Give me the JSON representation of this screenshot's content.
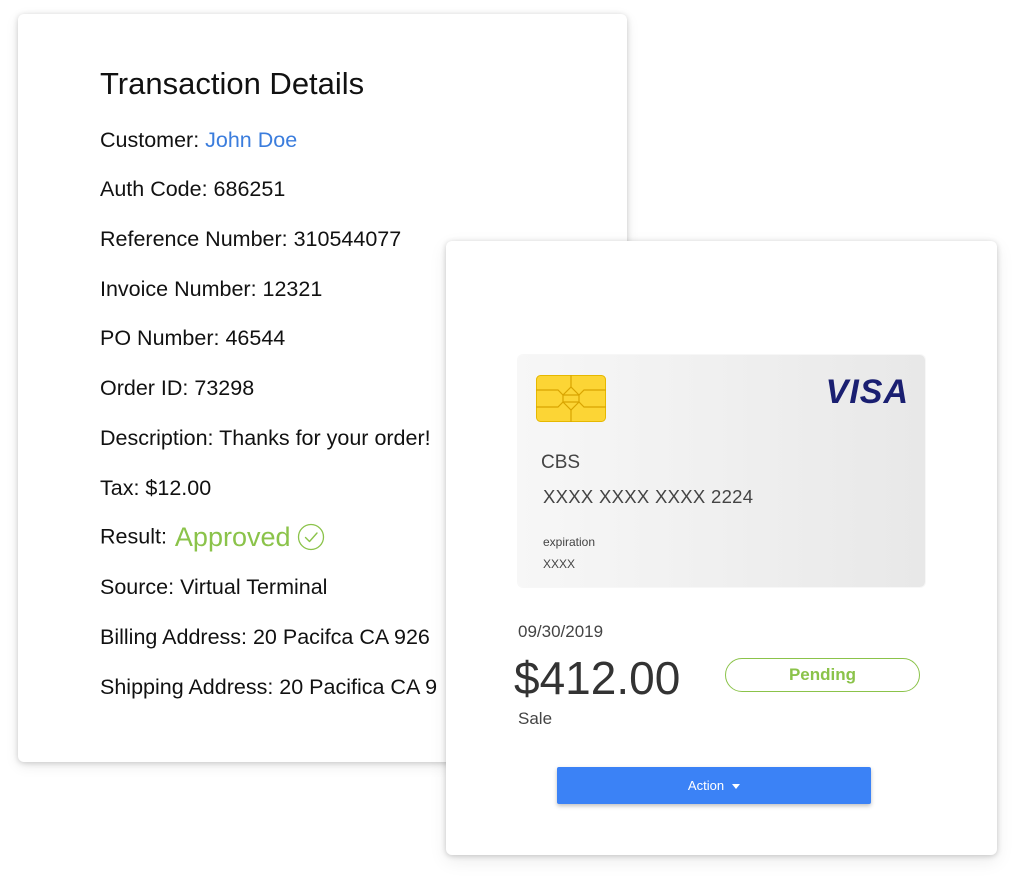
{
  "details": {
    "title": "Transaction Details",
    "customer_label": "Customer: ",
    "customer_name": "John Doe",
    "auth_code": "Auth Code: 686251",
    "reference_number": "Reference Number: 310544077",
    "invoice_number": "Invoice Number: 12321",
    "po_number": "PO Number: 46544",
    "order_id": "Order ID: 73298",
    "description": "Description: Thanks for your order!",
    "tax": "Tax: $12.00",
    "result_label": "Result:",
    "result_value": "Approved",
    "result_icon": "check-circle-icon",
    "source": "Source: Virtual Terminal",
    "billing_address": "Billing Address: 20 Pacifca CA 926",
    "shipping_address": "Shipping Address: 20 Pacifica CA 9"
  },
  "payment": {
    "card": {
      "brand": "VISA",
      "holder": "CBS",
      "number": "XXXX XXXX XXXX 2224",
      "expiration_label": "expiration",
      "expiration_value": "XXXX",
      "chip_icon": "chip-icon"
    },
    "date": "09/30/2019",
    "amount": "$412.00",
    "type": "Sale",
    "status": "Pending",
    "action_label": "Action",
    "action_icon": "caret-down-icon"
  },
  "colors": {
    "link_blue": "#3b7ddd",
    "approved_green": "#8bc34a",
    "visa_navy": "#1a1f71",
    "button_blue": "#3b82f6",
    "chip_gold": "#fcd535"
  }
}
